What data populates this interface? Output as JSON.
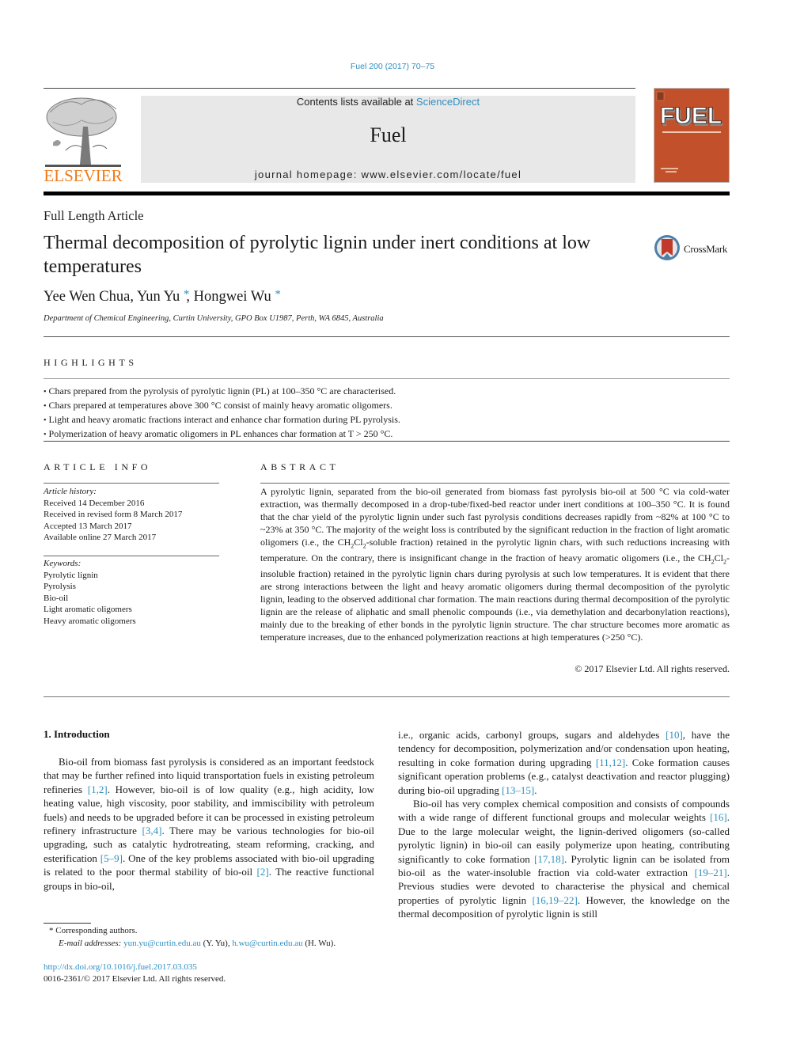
{
  "citation": "Fuel 200 (2017) 70–75",
  "header": {
    "contents_prefix": "Contents lists available at ",
    "contents_link": "ScienceDirect",
    "journal_name": "Fuel",
    "homepage": "journal homepage: www.elsevier.com/locate/fuel",
    "publisher_wordmark": "ELSEVIER",
    "cover_title": "FUEL",
    "brand_color": "#f07a16",
    "cover_color": "#c2512b",
    "link_color": "#2e8fc0"
  },
  "article": {
    "type": "Full Length Article",
    "title": "Thermal decomposition of pyrolytic lignin under inert conditions at low temperatures",
    "crossmark_label": "CrossMark",
    "authors": [
      {
        "name": "Yee Wen Chua",
        "corresponding": false
      },
      {
        "name": "Yun Yu",
        "corresponding": true
      },
      {
        "name": "Hongwei Wu",
        "corresponding": true
      }
    ],
    "author_separator": ", ",
    "corresponding_mark": "*",
    "affiliation": "Department of Chemical Engineering, Curtin University, GPO Box U1987, Perth, WA 6845, Australia"
  },
  "highlights": {
    "heading": "HIGHLIGHTS",
    "items": [
      "Chars prepared from the pyrolysis of pyrolytic lignin (PL) at 100–350 °C are characterised.",
      "Chars prepared at temperatures above 300 °C consist of mainly heavy aromatic oligomers.",
      "Light and heavy aromatic fractions interact and enhance char formation during PL pyrolysis.",
      "Polymerization of heavy aromatic oligomers in PL enhances char formation at T > 250 °C."
    ]
  },
  "article_info": {
    "heading": "ARTICLE INFO",
    "history_label": "Article history:",
    "history": [
      "Received 14 December 2016",
      "Received in revised form 8 March 2017",
      "Accepted 13 March 2017",
      "Available online 27 March 2017"
    ],
    "keywords_label": "Keywords:",
    "keywords": [
      "Pyrolytic lignin",
      "Pyrolysis",
      "Bio-oil",
      "Light aromatic oligomers",
      "Heavy aromatic oligomers"
    ]
  },
  "abstract": {
    "heading": "ABSTRACT",
    "segments": [
      "A pyrolytic lignin, separated from the bio-oil generated from biomass fast pyrolysis bio-oil at 500 °C via cold-water extraction, was thermally decomposed in a drop-tube/fixed-bed reactor under inert conditions at 100–350 °C. It is found that the char yield of the pyrolytic lignin under such fast pyrolysis conditions decreases rapidly from ~82% at 100 °C to ~23% at 350 °C. The majority of the weight loss is contributed by the significant reduction in the fraction of light aromatic oligomers (i.e., the CH",
      "2",
      "Cl",
      "2",
      "-soluble fraction) retained in the pyrolytic lignin chars, with such reductions increasing with temperature. On the contrary, there is insignificant change in the fraction of heavy aromatic oligomers (i.e., the CH",
      "2",
      "Cl",
      "2",
      "-insoluble fraction) retained in the pyrolytic lignin chars during pyrolysis at such low temperatures. It is evident that there are strong interactions between the light and heavy aromatic oligomers during thermal decomposition of the pyrolytic lignin, leading to the observed additional char formation. The main reactions during thermal decomposition of the pyrolytic lignin are the release of aliphatic and small phenolic compounds (i.e., via demethylation and decarbonylation reactions), mainly due to the breaking of ether bonds in the pyrolytic lignin structure. The char structure becomes more aromatic as temperature increases, due to the enhanced polymerization reactions at high temperatures (>250 °C)."
    ],
    "copyright": "© 2017 Elsevier Ltd. All rights reserved."
  },
  "intro": {
    "heading": "1. Introduction",
    "left": {
      "t1": "Bio-oil from biomass fast pyrolysis is considered as an important feedstock that may be further refined into liquid transportation fuels in existing petroleum refineries ",
      "c1": "[1,2]",
      "t2": ". However, bio-oil is of low quality (e.g., high acidity, low heating value, high viscosity, poor stability, and immiscibility with petroleum fuels) and needs to be upgraded before it can be processed in existing petroleum refinery infrastructure ",
      "c2": "[3,4]",
      "t3": ". There may be various technologies for bio-oil upgrading, such as catalytic hydrotreating, steam reforming, cracking, and esterification ",
      "c3": "[5–9]",
      "t4": ". One of the key problems associated with bio-oil upgrading is related to the poor thermal stability of bio-oil ",
      "c4": "[2]",
      "t5": ". The reactive functional groups in bio-oil,"
    },
    "right_p1": {
      "t1": "i.e., organic acids, carbonyl groups, sugars and aldehydes ",
      "c1": "[10]",
      "t2": ", have the tendency for decomposition, polymerization and/or condensation upon heating, resulting in coke formation during upgrading ",
      "c2": "[11,12]",
      "t3": ". Coke formation causes significant operation problems (e.g., catalyst deactivation and reactor plugging) during bio-oil upgrading ",
      "c3": "[13–15]",
      "t4": "."
    },
    "right_p2": {
      "t1": "Bio-oil has very complex chemical composition and consists of compounds with a wide range of different functional groups and molecular weights ",
      "c1": "[16]",
      "t2": ". Due to the large molecular weight, the lignin-derived oligomers (so-called pyrolytic lignin) in bio-oil can easily polymerize upon heating, contributing significantly to coke formation ",
      "c2": "[17,18]",
      "t3": ". Pyrolytic lignin can be isolated from bio-oil as the water-insoluble fraction via cold-water extraction ",
      "c3": "[19–21]",
      "t4": ". Previous studies were devoted to characterise the physical and chemical properties of pyrolytic lignin ",
      "c4": "[16,19–22]",
      "t5": ". However, the knowledge on the thermal decomposition of pyrolytic lignin is still"
    }
  },
  "footnotes": {
    "mark": "*",
    "corresponding": "Corresponding authors.",
    "email_label": "E-mail addresses:",
    "emails": [
      {
        "address": "yun.yu@curtin.edu.au",
        "who": " (Y. Yu), "
      },
      {
        "address": "h.wu@curtin.edu.au",
        "who": " (H. Wu)."
      }
    ],
    "doi": "http://dx.doi.org/10.1016/j.fuel.2017.03.035",
    "issn": "0016-2361/© 2017 Elsevier Ltd. All rights reserved."
  }
}
